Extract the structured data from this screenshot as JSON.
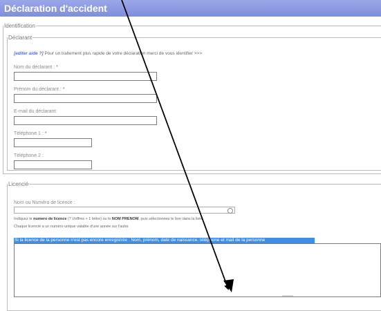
{
  "page": {
    "title": "Déclaration d'accident"
  },
  "identification": {
    "legend": "Identification",
    "declarant": {
      "legend": "Déclarant",
      "help_link": "[editer aide ?]",
      "help_text": "Pour un traitement plus rapide de votre déclaration merci de vous identifier >>>",
      "fields": [
        {
          "label": "Nom du déclarant :",
          "required": "*"
        },
        {
          "label": "Prénom du déclarant :",
          "required": "*"
        },
        {
          "label": "E-mail du déclarant:",
          "required": ""
        },
        {
          "label": "Téléphone 1 :",
          "required": "*"
        },
        {
          "label": "Téléphone 2 :",
          "required": ""
        }
      ]
    }
  },
  "licencie": {
    "legend": "Licencié",
    "search_label": "Nom ou Numéro de licence :",
    "hint_prefix": "Indiquez le",
    "hint_bold1": "numero de licence",
    "hint_mid": "(7 chiffres + 1 lettre) ou le",
    "hint_bold2": "NOM PRENOM",
    "hint_suffix": ", puis sélectionnez le bon dans la liste",
    "hint_line2": "Chaque licencié a un numéro unique valable d'une année sur l'autre",
    "highlight_text": "Si la licence de la personne n'est pas encore enregistrée : Nom, prénom, date de naissance, téléphone et mail de la personne"
  }
}
